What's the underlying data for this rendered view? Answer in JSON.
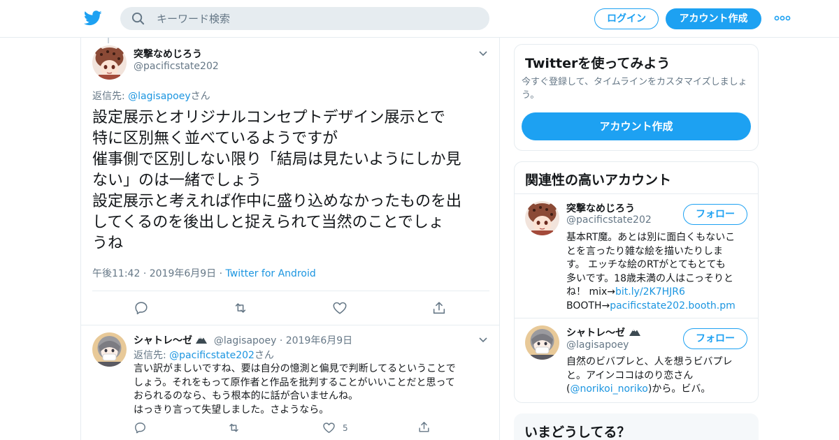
{
  "header": {
    "search_placeholder": "キーワード検索",
    "login_label": "ログイン",
    "signup_label": "アカウント作成"
  },
  "tweet1": {
    "name": "突撃なめじろう",
    "handle": "@pacificstate202",
    "reply_prefix": "返信先: ",
    "reply_to": "@lagisapoey",
    "reply_suffix": "さん",
    "text_lines": [
      "設定展示とオリジナルコンセプトデザイン展示とで",
      "特に区別無く並べているようですが",
      "催事側で区別しない限り「結局は見たいようにしか見",
      "ない」のは一緒でしょう",
      "設定展示と考えれば作中に盛り込めなかったものを出",
      "してくるのを後出しと捉えられて当然のことでしょ",
      "うね"
    ],
    "time": "午後11:42",
    "date": "2019年6月9日",
    "source": "Twitter for Android"
  },
  "tweet2": {
    "name": "シャトレ〜ゼ",
    "handle": "@lagisapoey",
    "date": "2019年6月9日",
    "reply_prefix": "返信先: ",
    "reply_to": "@pacificstate202",
    "reply_suffix": "さん",
    "text_lines": [
      "言い訳がましいですね、要は自分の憶測と偏見で判断してるということで",
      "しょう。それをもって原作者と作品を批判することがいいことだと思って",
      "おられるのなら、もう根本的に話が合いませんね。",
      "はっきり言って失望しました。さようなら。"
    ],
    "like_count": "5"
  },
  "signup_card": {
    "title": "Twitterを使ってみよう",
    "subtitle_lines": [
      "今すぐ登録して、タイムラインをカスタマイズしましょ",
      "う。"
    ],
    "button_label": "アカウント作成"
  },
  "related": {
    "title": "関連性の高いアカウント",
    "follow_label": "フォロー",
    "accounts": [
      {
        "name": "突撃なめじろう",
        "handle": "@pacificstate202",
        "bio_lines": [
          "基本RT魔。あとは別に面白くもないこ",
          "とを言ったり雑な絵を描いたりしま",
          "す。 エッチな絵のRTがとてもとても",
          "多いです。18歳未満の人はこっそりと"
        ],
        "bio_line5_prefix": "ね！ mix→",
        "bio_link1": "bit.ly/2K7HJR6",
        "bio_line6_prefix": "BOOTH→",
        "bio_link2": "pacificstate202.booth.pm"
      },
      {
        "name": "シャトレ〜ゼ",
        "handle": "@lagisapoey",
        "bio_lines": [
          "自然のビバプレと、人を想うビバプレ",
          "と。アインココはのり恋さん"
        ],
        "bio_line3_prefix": "(",
        "bio_link": "@norikoi_noriko",
        "bio_line3_suffix": ")から。ビバ。"
      }
    ]
  },
  "trends_card": {
    "title": "いまどうしてる？"
  },
  "colors": {
    "accent": "#1da1f2",
    "link": "#1b95e0",
    "text": "#14171a",
    "muted": "#657786",
    "border": "#e6ecf0"
  }
}
